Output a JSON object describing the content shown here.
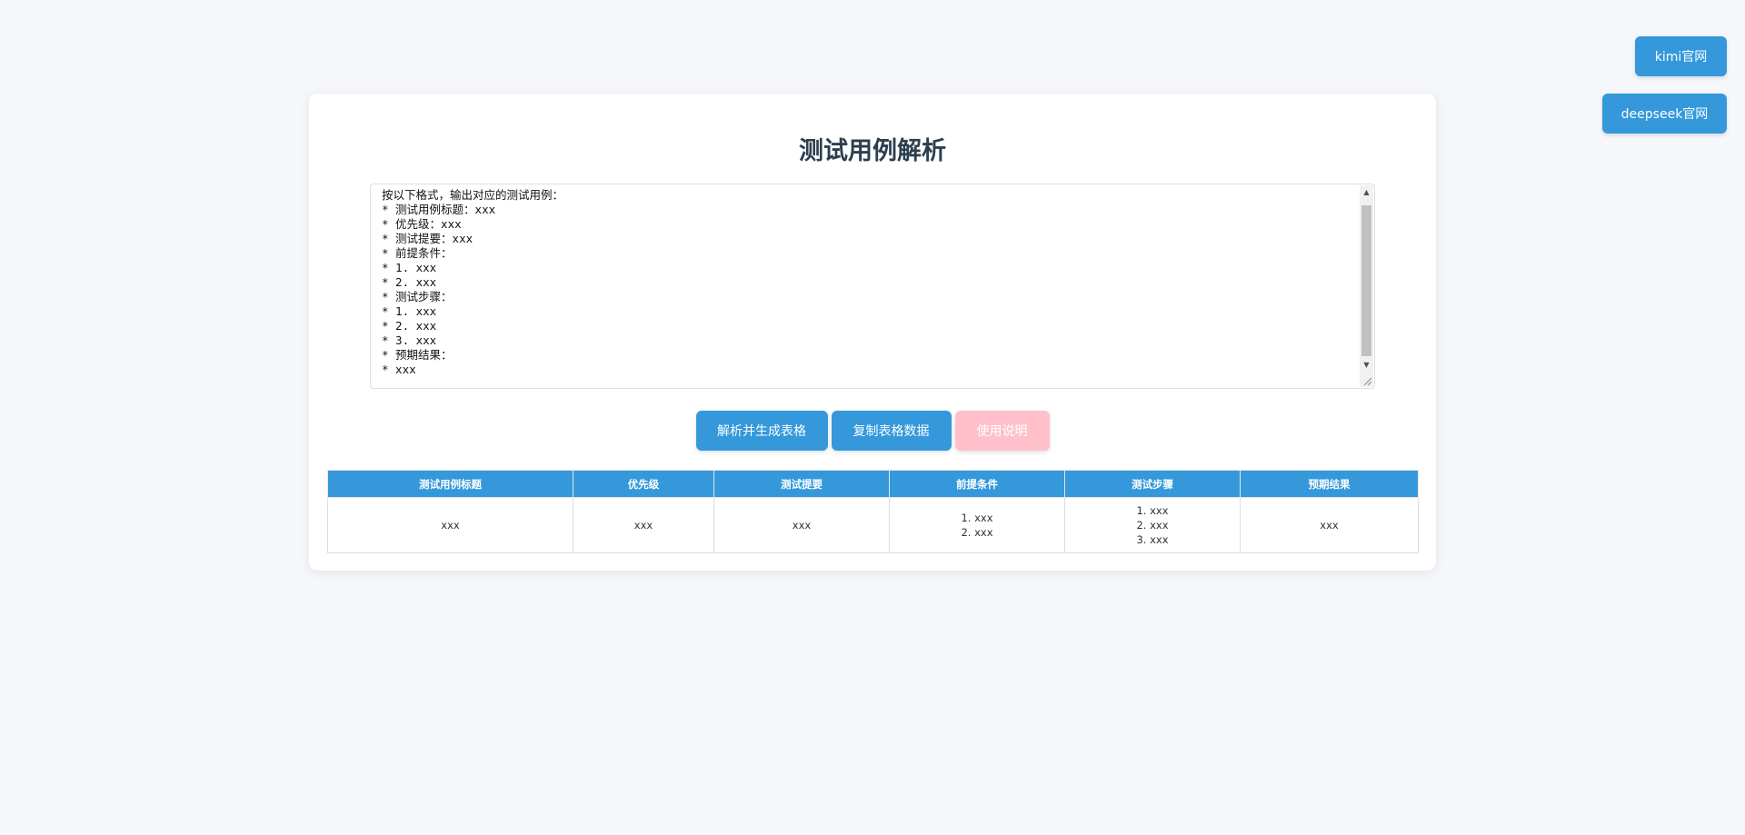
{
  "header": {
    "kimi_label": "kimi官网",
    "deepseek_label": "deepseek官网"
  },
  "main": {
    "title": "测试用例解析",
    "textarea_lines": [
      "按以下格式，输出对应的测试用例：",
      "* 测试用例标题：xxx",
      "* 优先级：xxx",
      "* 测试提要：xxx",
      "* 前提条件：",
      "* 1. xxx",
      "* 2. xxx",
      "* 测试步骤：",
      "* 1. xxx",
      "* 2. xxx",
      "* 3. xxx",
      "* 预期结果：",
      "* xxx"
    ],
    "buttons": {
      "parse": "解析并生成表格",
      "copy": "复制表格数据",
      "help": "使用说明"
    },
    "table": {
      "headers": [
        "测试用例标题",
        "优先级",
        "测试提要",
        "前提条件",
        "测试步骤",
        "预期结果"
      ],
      "rows": [
        [
          "xxx",
          "xxx",
          "xxx",
          "1. xxx\n2. xxx",
          "1. xxx\n2. xxx\n3. xxx",
          "xxx"
        ]
      ]
    }
  },
  "colors": {
    "primary": "#3498db",
    "help_button": "#ffc0cb",
    "title": "#2c3e50",
    "background": "#f5f7fa"
  }
}
